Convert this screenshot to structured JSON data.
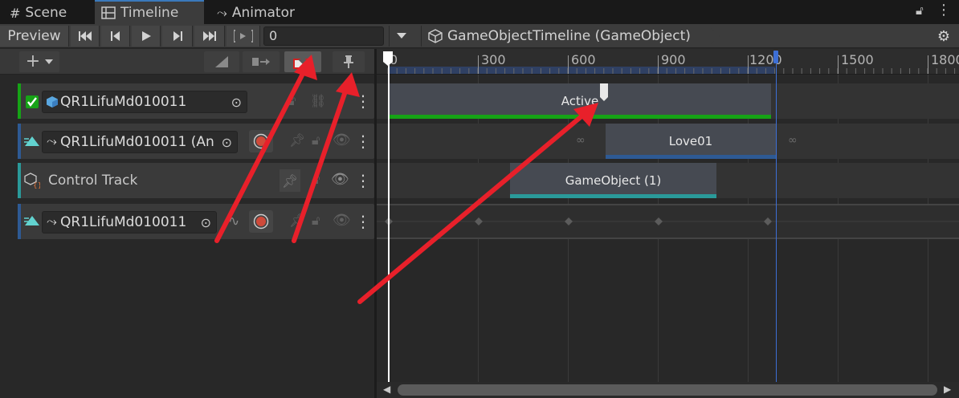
{
  "tabs": [
    {
      "label": "Scene",
      "icon": "grid-icon"
    },
    {
      "label": "Timeline",
      "icon": "timeline-icon",
      "active": true
    },
    {
      "label": "Animator",
      "icon": "animator-icon"
    }
  ],
  "toolbar": {
    "preview_label": "Preview",
    "frame_value": "0",
    "breadcrumb": "GameObjectTimeline (GameObject)"
  },
  "ruler": {
    "ticks": [
      "0",
      "300",
      "600",
      "900",
      "1200",
      "1500",
      "1800"
    ]
  },
  "tracks": [
    {
      "name": "QR1LifuMd010011",
      "type": "activation",
      "stripe_color": "#16a316"
    },
    {
      "name": "QR1LifuMd010011 (An",
      "type": "animation",
      "stripe_color": "#2e5a94"
    },
    {
      "name": "Control Track",
      "type": "control",
      "stripe_color": "#2a9a9a"
    },
    {
      "name": "QR1LifuMd010011",
      "type": "animation",
      "stripe_color": "#2e5a94"
    }
  ],
  "clips": {
    "active": {
      "label": "Active",
      "accent": "#16a316"
    },
    "love": {
      "label": "Love01",
      "accent": "#2e5a94"
    },
    "gameobject": {
      "label": "GameObject (1)",
      "accent": "#2a9a9a"
    }
  },
  "colors": {
    "annotation_arrow": "#e8202a",
    "playhead": "#ffffff",
    "end_marker": "#3d6fd6"
  }
}
